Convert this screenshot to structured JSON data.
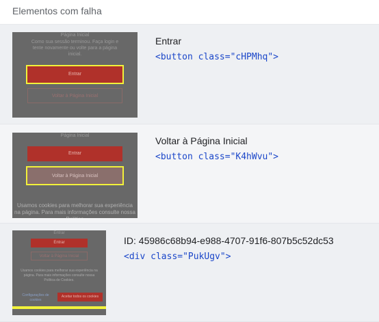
{
  "header": {
    "title": "Elementos com falha"
  },
  "items": [
    {
      "title": "Entrar",
      "code": "<button class=\"cHPMhq\">",
      "thumb": {
        "heading": "Página Inicial",
        "text": "Como sua sessão terminou. Faça login e tente novamente ou volte para a página inicial.",
        "primary": "Entrar",
        "secondary": "Voltar à Página Inicial"
      }
    },
    {
      "title": "Voltar à Página Inicial",
      "code": "<button class=\"K4hWvu\">",
      "thumb": {
        "heading": "Página Inicial",
        "primary": "Entrar",
        "secondary": "Voltar à Página Inicial",
        "cookie": "Usamos cookies para melhorar sua experiência na página. Para mais informações consulte nossa Política"
      }
    },
    {
      "title": "ID: 45986c68b94-e988-4707-91f6-807b5c52dc53",
      "code": "<div class=\"PukUgv\">",
      "thumb": {
        "heading": "Entrar",
        "primary": "Entrar",
        "secondary": "Voltar à Página Inicial",
        "cookie": "Usamos cookies para melhorar sua experiência na página. Para mais informações consulte nossa Política de Cookies.",
        "settings": "Configurações de cookies",
        "accept": "Aceitar todos os cookies"
      }
    }
  ],
  "colors": {
    "highlight": "#f2f23a",
    "code": "#1a46c9",
    "danger": "#b0312a"
  }
}
